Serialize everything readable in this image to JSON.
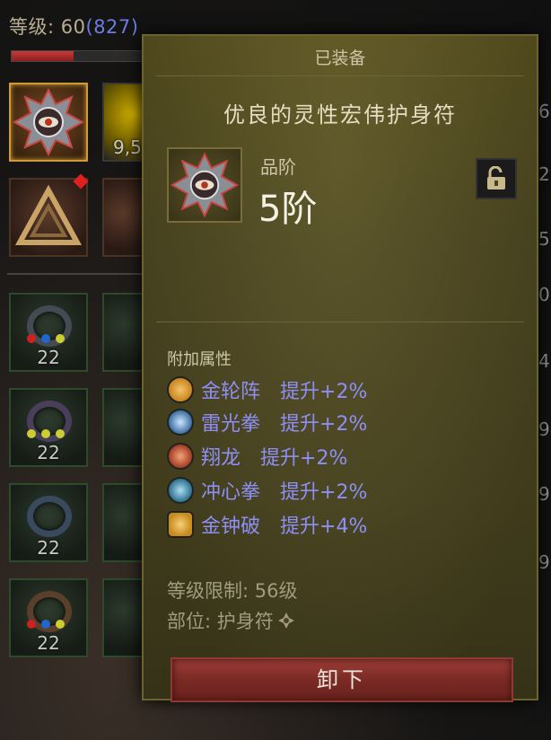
{
  "hud": {
    "level_label": "等级:",
    "level_value": "60",
    "level_extra": "(827)",
    "xp_fraction": 0.47,
    "visible_counts": {
      "slot_1_2": "9,5",
      "gem_levels": [
        "22",
        "22",
        "22",
        "22"
      ]
    },
    "edge_digits": [
      "6",
      "2",
      "5",
      "0",
      "4",
      "9",
      "9",
      "9"
    ]
  },
  "tooltip": {
    "header": "已装备",
    "item_name": "优良的灵性宏伟护身符",
    "grade_label": "品阶",
    "grade_value": "5阶",
    "lock_icon": "unlock-icon",
    "attributes_title": "附加属性",
    "attributes": [
      {
        "skill": "金轮阵",
        "bonus": "提升+2%",
        "icon": "golden-wheel-icon",
        "color": "#c8841e"
      },
      {
        "skill": "雷光拳",
        "bonus": "提升+2%",
        "icon": "thunder-fist-icon",
        "color": "#3b6fa0"
      },
      {
        "skill": "翔龙",
        "bonus": "提升+2%",
        "icon": "soaring-dragon-icon",
        "color": "#a23d22"
      },
      {
        "skill": "冲心拳",
        "bonus": "提升+2%",
        "icon": "heart-strike-icon",
        "color": "#2f6f8c"
      },
      {
        "skill": "金钟破",
        "bonus": "提升+4%",
        "icon": "golden-bell-icon",
        "color": "#c68a1c"
      }
    ],
    "level_requirement": "等级限制: 56级",
    "slot": "部位: 护身符",
    "unequip_label": "卸下"
  },
  "colors": {
    "attribute_text": "#8e8ff6",
    "button": "#8c3a32",
    "panel": "#4f4a22"
  }
}
